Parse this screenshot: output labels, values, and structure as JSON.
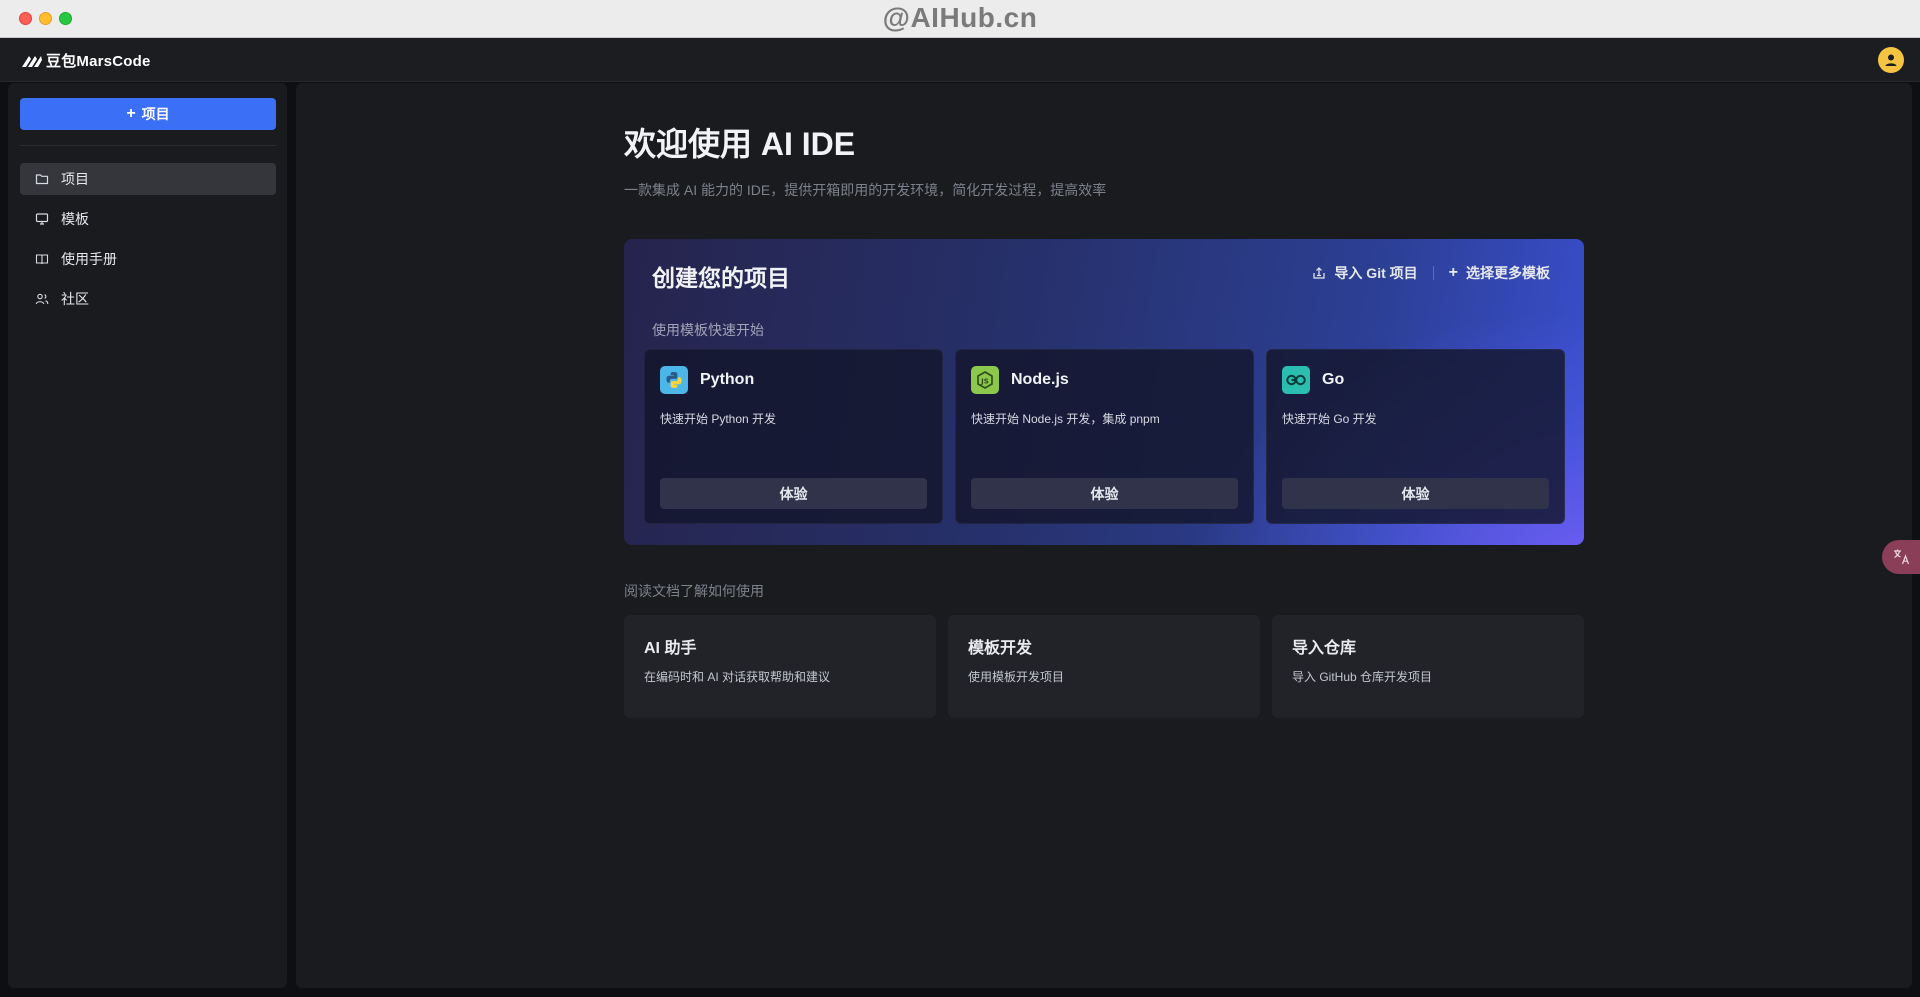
{
  "window": {
    "watermark": "@AIHub.cn"
  },
  "header": {
    "brand": "豆包MarsCode",
    "brand_icon": "marscode-logo",
    "avatar_icon": "user-avatar"
  },
  "sidebar": {
    "new_project_label": "项目",
    "items": [
      {
        "label": "项目",
        "icon": "folder-icon",
        "active": true
      },
      {
        "label": "模板",
        "icon": "monitor-icon",
        "active": false
      },
      {
        "label": "使用手册",
        "icon": "book-icon",
        "active": false
      },
      {
        "label": "社区",
        "icon": "users-icon",
        "active": false
      }
    ]
  },
  "main": {
    "title": "欢迎使用 AI IDE",
    "subtitle": "一款集成 AI 能力的 IDE，提供开箱即用的开发环境，简化开发过程，提高效率",
    "create": {
      "title": "创建您的项目",
      "import_git_label": "导入 Git 项目",
      "more_templates_label": "选择更多模板",
      "template_hint": "使用模板快速开始",
      "templates": [
        {
          "name": "Python",
          "desc": "快速开始 Python 开发",
          "button": "体验",
          "icon": "python-icon",
          "color": "#4db6e8"
        },
        {
          "name": "Node.js",
          "desc": "快速开始 Node.js 开发，集成 pnpm",
          "button": "体验",
          "icon": "nodejs-icon",
          "color": "#8cc84b"
        },
        {
          "name": "Go",
          "desc": "快速开始 Go 开发",
          "button": "体验",
          "icon": "go-icon",
          "color": "#29beb0"
        }
      ]
    },
    "docs_hint": "阅读文档了解如何使用",
    "docs": [
      {
        "title": "AI 助手",
        "desc": "在编码时和 AI 对话获取帮助和建议"
      },
      {
        "title": "模板开发",
        "desc": "使用模板开发项目"
      },
      {
        "title": "导入仓库",
        "desc": "导入 GitHub 仓库开发项目"
      }
    ]
  },
  "floating": {
    "translate_icon": "translate-icon"
  },
  "colors": {
    "accent": "#3b6ff6",
    "background": "#0e0f12",
    "panel": "#1a1b1f"
  }
}
